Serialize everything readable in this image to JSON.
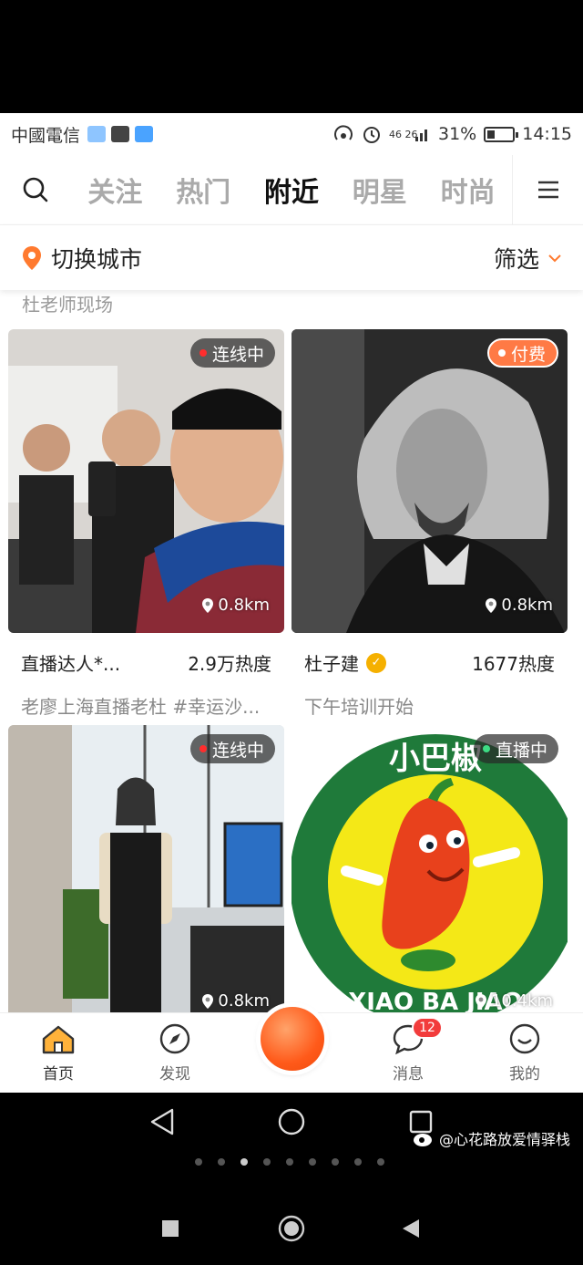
{
  "status": {
    "carrier": "中國電信",
    "battery_pct": "31%",
    "battery_level": 0.31,
    "time": "14:15",
    "signal": "46 26"
  },
  "nav": {
    "tabs": [
      "关注",
      "热门",
      "附近",
      "明星",
      "时尚"
    ],
    "active_tab": "附近"
  },
  "citybar": {
    "city_label": "切换城市",
    "filter_label": "筛选"
  },
  "partial_text": "杜老师现场",
  "cards": [
    {
      "badge": "连线中",
      "badge_dot_color": "#ff2d2d",
      "distance": "0.8km",
      "name": "直播达人*...",
      "heat": "2.9万热度",
      "desc": "老廖上海直播老杜 #幸运沙..."
    },
    {
      "badge": "付费",
      "badge_dot_color": "#ffffff",
      "distance": "0.8km",
      "name": "杜子建",
      "heat": "1677热度",
      "desc": "下午培训开始"
    },
    {
      "badge": "连线中",
      "badge_dot_color": "#ff2d2d",
      "distance": "0.8km"
    },
    {
      "badge": "直播中",
      "badge_dot_color": "#3ddc84",
      "distance": "10.4km",
      "logo_top_text": "小巴椒",
      "logo_bottom_text": "XIAO BA JIAO"
    }
  ],
  "tabbar": {
    "items": [
      "首页",
      "发现",
      "消息",
      "我的"
    ],
    "message_count": "12"
  },
  "watermark": "@心花路放爱情驿栈",
  "colors": {
    "accent": "#ff7a2f",
    "live_dot": "#3ddc84",
    "connect_dot": "#ff2d2d"
  }
}
